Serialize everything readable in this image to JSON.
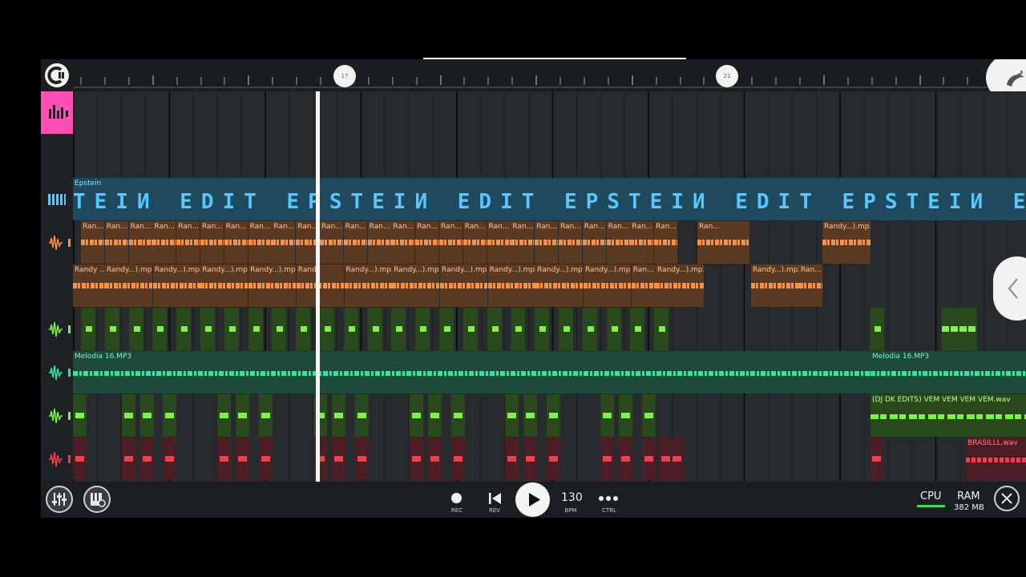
{
  "ruler": {
    "markers": [
      "17",
      "21"
    ]
  },
  "tracks": {
    "epstein": {
      "label": "Epstein",
      "banner": "TEIИ EDIT EPSTEIИ EDIT EPSTEIИ EDIT EPSTEIИ E"
    },
    "orange1": {
      "clip_label_short": "Ran...",
      "clip_label_long": "Randy...).mp3"
    },
    "orange2": {
      "first_label": "Randy ...",
      "clip_label": "Randy...).mp3",
      "short_label": "Ran...",
      "partial_label": "Rand"
    },
    "melodia": {
      "label": "Melodia 16.MP3"
    },
    "vem": {
      "label": "(DJ DK EDITS) VEM VEM VEM VEM.wav"
    },
    "brasil": {
      "label": "BRASILLL.wav"
    }
  },
  "transport": {
    "rec_label": "REC",
    "rev_label": "REV",
    "tempo": "130",
    "bpm_label": "BPM",
    "ctrl_label": "CTRL"
  },
  "status": {
    "cpu_label": "CPU",
    "ram_label": "RAM",
    "ram_value": "382 MB"
  },
  "colors": {
    "pink": "#ff4fb4",
    "orange": "#ff8f3a",
    "green": "#7cf542",
    "teal": "#2ee89a",
    "red": "#ff3a4a",
    "blue": "#57c8ff"
  }
}
